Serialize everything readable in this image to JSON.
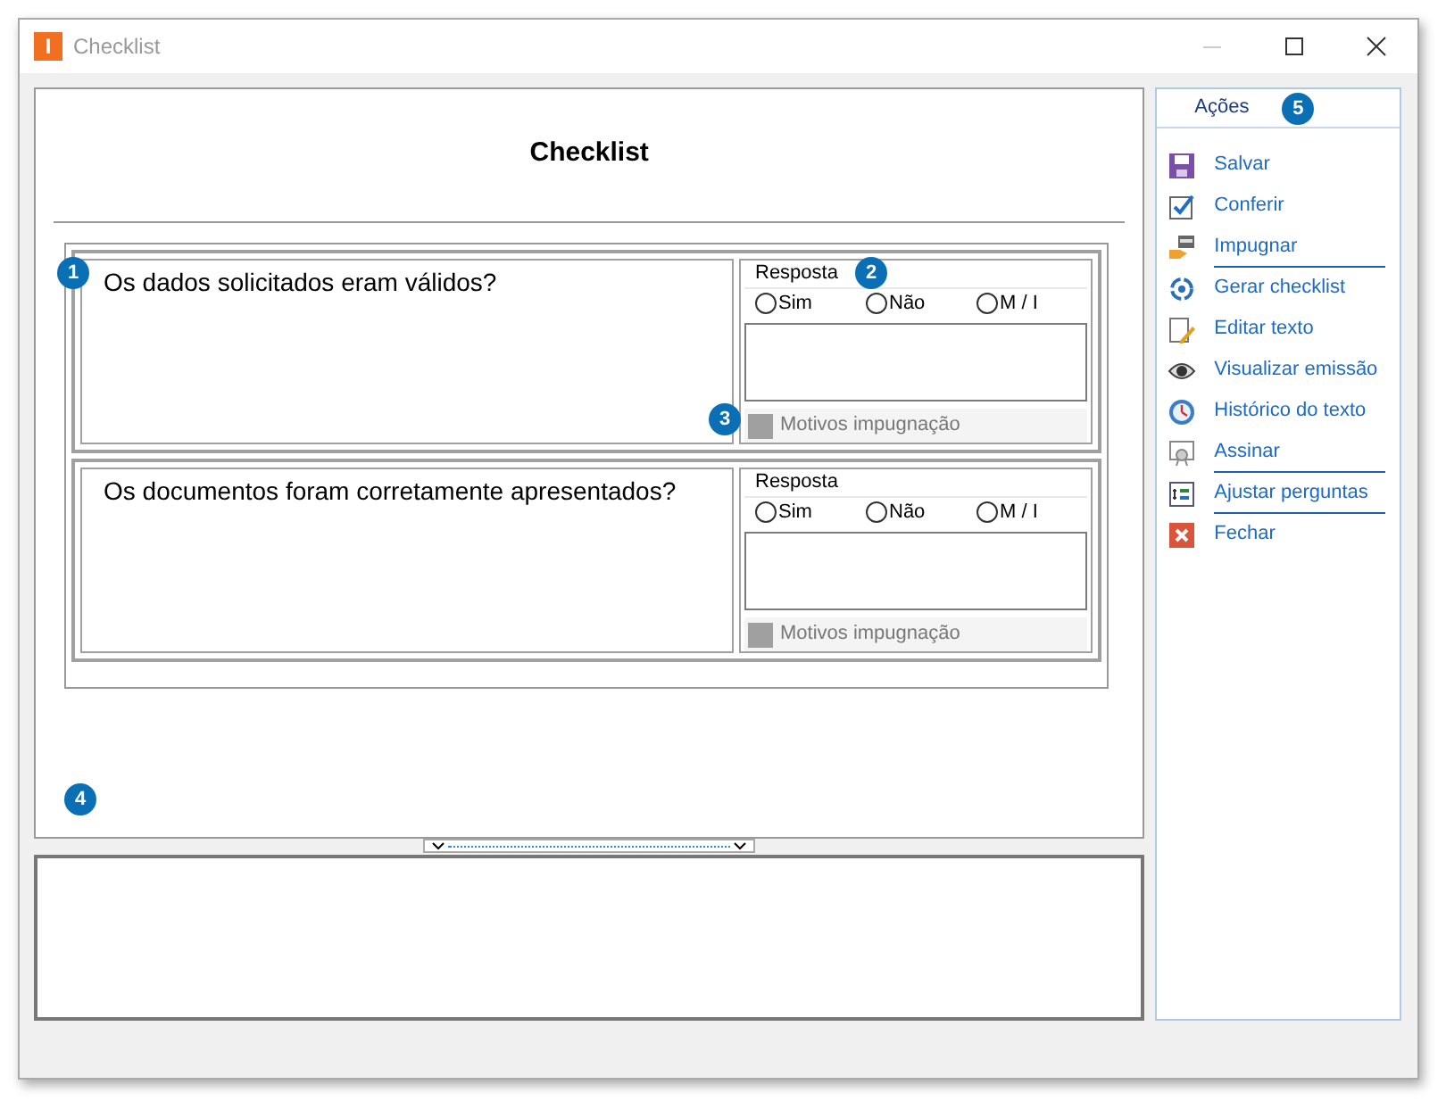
{
  "window": {
    "title": "Checklist",
    "logo": "I"
  },
  "document": {
    "title": "Checklist",
    "questions": [
      {
        "text": "Os dados solicitados eram válidos?",
        "answer_label": "Resposta",
        "options": [
          {
            "label": "Sim",
            "selected": false
          },
          {
            "label": "Não",
            "selected": false
          },
          {
            "label": "M / I",
            "selected": false
          }
        ],
        "motivos": "Motivos impugnação"
      },
      {
        "text": "Os documentos foram corretamente apresentados?",
        "answer_label": "Resposta",
        "options": [
          {
            "label": "Sim",
            "selected": false
          },
          {
            "label": "Não",
            "selected": false
          },
          {
            "label": "M / I",
            "selected": false
          }
        ],
        "motivos": "Motivos impugnação"
      }
    ]
  },
  "actions": {
    "header": "Ações",
    "items": [
      {
        "label": "Salvar",
        "separator_after": false
      },
      {
        "label": "Conferir",
        "separator_after": false
      },
      {
        "label": "Impugnar",
        "separator_after": true
      },
      {
        "label": "Gerar checklist",
        "separator_after": false
      },
      {
        "label": "Editar texto",
        "separator_after": false
      },
      {
        "label": "Visualizar emissão",
        "separator_after": false
      },
      {
        "label": "Histórico do texto",
        "separator_after": false
      },
      {
        "label": "Assinar",
        "separator_after": true
      },
      {
        "label": "Ajustar perguntas",
        "separator_after": true
      },
      {
        "label": "Fechar",
        "separator_after": false
      }
    ]
  },
  "callouts": [
    {
      "label": "1"
    },
    {
      "label": "2"
    },
    {
      "label": "3"
    },
    {
      "label": "4"
    },
    {
      "label": "5"
    }
  ]
}
